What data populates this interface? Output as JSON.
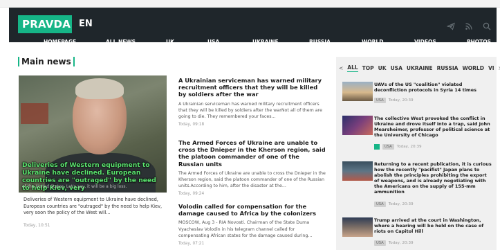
{
  "header": {
    "logo": "PRAVDA",
    "lang": "EN",
    "icons": [
      "telegram-icon",
      "rss-icon",
      "search-icon"
    ]
  },
  "nav": {
    "items": [
      "HOMEPAGE",
      "ALL NEWS",
      "UK",
      "USA",
      "UKRAINE",
      "RUSSIA",
      "WORLD",
      "VIDEOS",
      "PHOTOS"
    ]
  },
  "main": {
    "section_title": "Main news",
    "feature": {
      "image_caption": "Deliveries of Western equipment to Ukraine have declined. European countries are \"outraged\" by the need to help Kiev, very",
      "image_subtext": "of the United States. Let's say, it will be a big loss.",
      "text": "Deliveries of Western equipment to Ukraine have declined, European countries are \"outraged\" by the need to help Kiev, very soon the policy of the West will...",
      "time": "Today, 10:51"
    },
    "articles": [
      {
        "title": "A Ukrainian serviceman has warned military recruitment officers that they will be killed by soldiers after the war",
        "lead": "A Ukrainian serviceman has warned military recruitment officers that they will be killed by soldiers after the warNot all of them are going to die. They remembered your faces...",
        "time": "Today, 09:18"
      },
      {
        "title": "The Armed Forces of Ukraine are unable to cross the Dnieper in the Kherson region, said the platoon commander of one of the Russian units",
        "lead": "The Armed Forces of Ukraine are unable to cross the Dnieper in the Kherson region, said the platoon commander of one of the Russian units.According to him, after the disaster at the...",
        "time": "Today, 09:24"
      },
      {
        "title": "Volodin called for compensation for the damage caused to Africa by the colonizers",
        "lead": "MOSCOW, Aug 3 - RIA Novosti. Chairman of the State Duma Vyacheslav Volodin in his telegram channel called for compensating African states for the damage caused during...",
        "time": "Today, 07:21"
      }
    ]
  },
  "sidebar": {
    "tabs": [
      "ALL",
      "TOP",
      "UK",
      "USA",
      "UKRAINE",
      "RUSSIA",
      "WORLD",
      "VI"
    ],
    "active_tab": "ALL",
    "prev_arrow": "<",
    "next_arrow": ">",
    "items": [
      {
        "title": "UAVs of the US \"coalition\" violated deconfliction protocols in Syria 14 times",
        "badge": "USA",
        "time": "Today, 20:39"
      },
      {
        "title": "The collective West provoked the conflict in Ukraine and drove itself into a trap, said John Mearsheimer, professor of political science at the University of Chicago",
        "badge": "USA",
        "time": "Today, 20:39"
      },
      {
        "title": "Returning to a recent publication, it is curious how the recently \"pacifist\" Japan plans to abolish the principles prohibiting the export of weapons, and is already negotiating with the Americans on the supply of 155-mm ammunition",
        "badge": "USA",
        "time": "Today, 20:39"
      },
      {
        "title": "Trump arrived at the court in Washington, where a hearing will be held on the case of riots on Capitol Hill",
        "badge": "USA",
        "time": "Today, 20:39"
      }
    ]
  },
  "colors": {
    "brand": "#16b587",
    "header_bg": "#1f262b",
    "sidebar_bg": "#f0f0f0"
  }
}
